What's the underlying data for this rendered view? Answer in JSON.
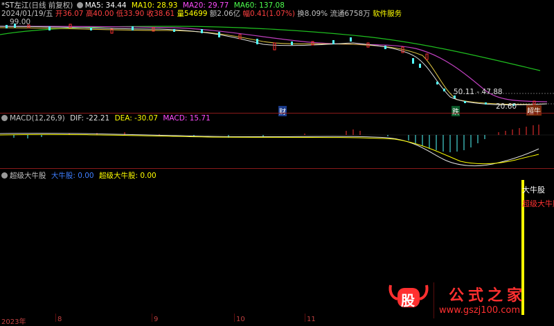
{
  "header": {
    "stock_name": "*ST左江",
    "adjust": "(日线 前复权)",
    "ma5_label": "MA5: 34.44",
    "ma10_label": "MA10: 28.93",
    "ma20_label": "MA20: 29.77",
    "ma60_label": "MA60: 137.08"
  },
  "info": {
    "date": "2024/01/19/五",
    "open": "开36.07",
    "high": "高40.00",
    "low": "低33.90",
    "close": "收38.61",
    "volume": "量54699",
    "amount": "额2.06亿",
    "range": "幅0.41(1.07%)",
    "turnover": "换8.09%",
    "float": "流通6758万",
    "industry": "软件服务"
  },
  "price_labels": {
    "top_price": "99.00",
    "range_label": "50.11 - 47.88",
    "low_price": "20.60"
  },
  "markers": {
    "cai": "财",
    "die": "跌",
    "badge": "超牛"
  },
  "macd": {
    "title": "MACD(12,26,9)",
    "dif": "DIF: -22.21",
    "dea": "DEA: -30.07",
    "macd": "MACD: 15.71"
  },
  "indicator": {
    "title": "超级大牛股",
    "big_bull": "大牛股: 0.00",
    "super_bull": "超级大牛股: 0.00",
    "bar_label_1": "大牛股",
    "bar_label_2": "超级大牛股"
  },
  "timeline": {
    "ticks": [
      "2023年",
      "8",
      "9",
      "10",
      "11"
    ]
  },
  "watermark": {
    "brand_glyph": "股",
    "brand_name": "公式之家",
    "url": "www.gszj100.com"
  },
  "colors": {
    "ma5": "#ffffff",
    "ma10": "#ffff00",
    "ma20": "#ff00ff",
    "ma60": "#00ff00",
    "up": "#ff3232",
    "down": "#54ffff",
    "divider": "#8b1a1a"
  }
}
